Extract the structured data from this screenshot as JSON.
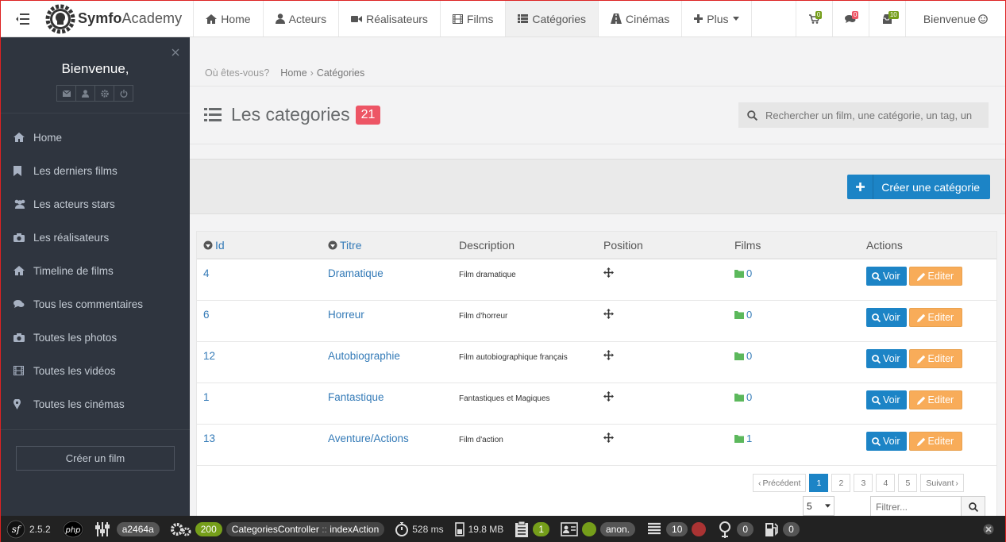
{
  "brand": {
    "part1": "Symfo",
    "part2": "Academy"
  },
  "nav": {
    "items": [
      {
        "key": "home",
        "label": "Home",
        "icon": "home-icon"
      },
      {
        "key": "acteurs",
        "label": "Acteurs",
        "icon": "user-icon"
      },
      {
        "key": "realisateurs",
        "label": "Réalisateurs",
        "icon": "video-camera-icon"
      },
      {
        "key": "films",
        "label": "Films",
        "icon": "film-icon"
      },
      {
        "key": "categories",
        "label": "Catégories",
        "icon": "list-icon"
      },
      {
        "key": "cinemas",
        "label": "Cinémas",
        "icon": "road-icon"
      },
      {
        "key": "plus",
        "label": "Plus",
        "icon": "plus-icon"
      }
    ],
    "cart_count": "0",
    "comments_count": "0",
    "mail_count": "10",
    "welcome": "Bienvenue"
  },
  "sidebar": {
    "welcome": "Bienvenue,",
    "menu": [
      {
        "label": "Home",
        "icon": "home-icon"
      },
      {
        "label": "Les derniers films",
        "icon": "bookmark-icon"
      },
      {
        "label": "Les acteurs stars",
        "icon": "users-icon"
      },
      {
        "label": "Les réalisateurs",
        "icon": "camera-icon"
      },
      {
        "label": "Timeline de films",
        "icon": "home-icon"
      },
      {
        "label": "Tous les commentaires",
        "icon": "comments-icon"
      },
      {
        "label": "Toutes les photos",
        "icon": "camera-icon"
      },
      {
        "label": "Toutes les vidéos",
        "icon": "film-icon"
      },
      {
        "label": "Toutes les cinémas",
        "icon": "map-marker-icon"
      }
    ],
    "create_button": "Créer un film"
  },
  "breadcrumb": {
    "prefix": "Où êtes-vous?",
    "home": "Home",
    "current": "Catégories"
  },
  "page": {
    "title": "Les categories",
    "count": "21"
  },
  "search": {
    "placeholder": "Rechercher un film, une catégorie, un tag, un"
  },
  "toolbar": {
    "create_label": "Créer une catégorie"
  },
  "table": {
    "headers": {
      "id": "Id",
      "title": "Titre",
      "description": "Description",
      "position": "Position",
      "films": "Films",
      "actions": "Actions"
    },
    "rows": [
      {
        "id": "4",
        "title": "Dramatique",
        "description": "Film dramatique",
        "films": "0"
      },
      {
        "id": "6",
        "title": "Horreur",
        "description": "Film d'horreur",
        "films": "0"
      },
      {
        "id": "12",
        "title": "Autobiographie",
        "description": "Film autobiographique français",
        "films": "0"
      },
      {
        "id": "1",
        "title": "Fantastique",
        "description": "Fantastiques et Magiques",
        "films": "0"
      },
      {
        "id": "13",
        "title": "Aventure/Actions",
        "description": "Film d'action",
        "films": "1"
      }
    ],
    "voir_label": "Voir",
    "edit_label": "Editer"
  },
  "pagination": {
    "prev": "Précédent",
    "pages": [
      "1",
      "2",
      "3",
      "4",
      "5"
    ],
    "active": "1",
    "next": "Suivant"
  },
  "per_page": "5",
  "filter": {
    "placeholder": "Filtrer..."
  },
  "debug": {
    "version": "2.5.2",
    "token": "a2464a",
    "status": "200",
    "controller": "CategoriesController",
    "action": "indexAction",
    "time": "528 ms",
    "memory": "19.8 MB",
    "logs": "1",
    "user": "anon.",
    "queries": "10",
    "twig": "0",
    "cache": "0"
  },
  "colors": {
    "primary": "#1c84c6",
    "warning": "#f8ac59",
    "danger": "#ed5565",
    "sidebar": "#2f353f",
    "success": "#759e1a"
  }
}
